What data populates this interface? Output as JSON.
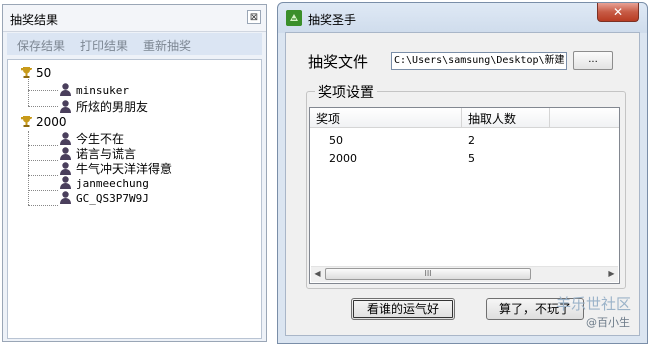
{
  "results_window": {
    "title": "抽奖结果",
    "close_glyph": "⊠",
    "menu": [
      "保存结果",
      "打印结果",
      "重新抽奖"
    ],
    "tree": [
      {
        "prize": "50",
        "winners": [
          "minsuker",
          "所炫的男朋友"
        ]
      },
      {
        "prize": "2000",
        "winners": [
          "今生不在",
          "诺言与谎言",
          "牛气冲天洋洋得意",
          "janmeechung",
          "GC_QS3P7W9J"
        ]
      }
    ]
  },
  "main_window": {
    "title": "抽奖圣手",
    "close_glyph": "✕",
    "file_label": "抽奖文件",
    "file_path": "C:\\Users\\samsung\\Desktop\\新建",
    "browse_label": "...",
    "group_title": "奖项设置",
    "columns": [
      "奖项",
      "抽取人数"
    ],
    "rows": [
      [
        "50",
        "2"
      ],
      [
        "2000",
        "5"
      ]
    ],
    "scroll_left": "◀",
    "scroll_right": "▶",
    "scroll_grip": "III",
    "draw_button": "看谁的运气好",
    "quit_button": "算了，不玩了"
  },
  "watermark": {
    "site": "羊乐世社区",
    "author": "@百小生"
  },
  "colors": {
    "trophy": "#c89a1a",
    "person": "#4a3f5c",
    "accent": "#dbe5f3"
  }
}
